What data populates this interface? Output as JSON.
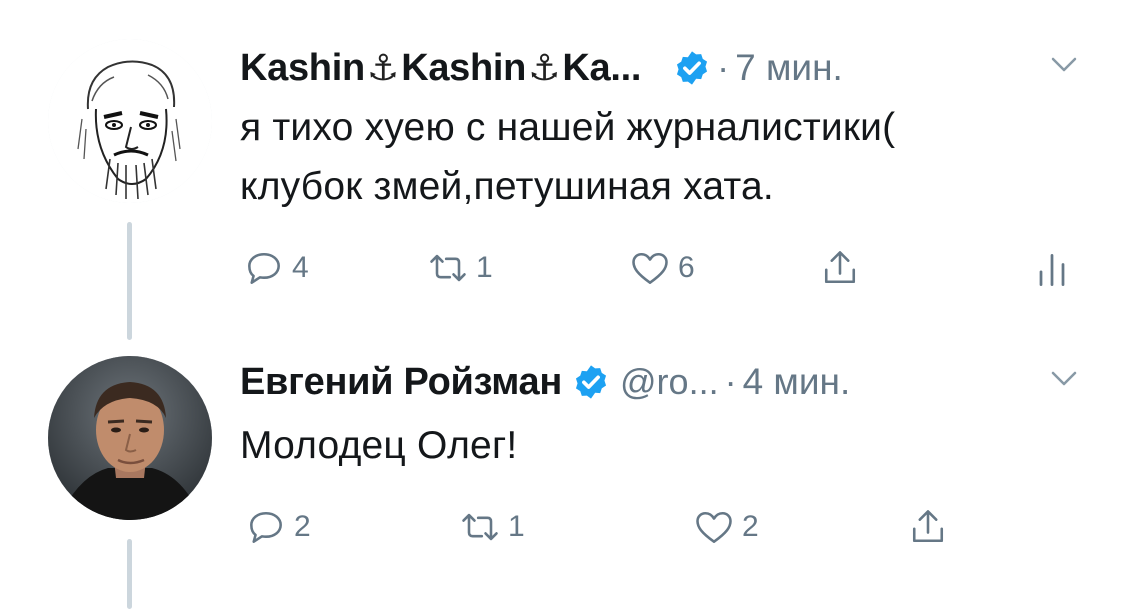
{
  "tweets": [
    {
      "name_part1": "Kashin",
      "name_part2": "Kashin",
      "name_part3": "Ka...",
      "anchor": "⚓",
      "dot": "·",
      "time": "7 мин.",
      "text": "я тихо хуею с нашей журналистики(\nклубок змей,петушиная хата.",
      "reply_count": "4",
      "retweet_count": "1",
      "like_count": "6"
    },
    {
      "name": "Евгений Ройзман",
      "handle": "@ro...",
      "dot": "·",
      "time": "4 мин.",
      "text": "Молодец Олег!",
      "reply_count": "2",
      "retweet_count": "1",
      "like_count": "2"
    }
  ],
  "colors": {
    "text": "#14171a",
    "secondary": "#657786",
    "verified": "#1da1f2",
    "thread_line": "#ccd6dd"
  },
  "icons": [
    "reply-icon",
    "retweet-icon",
    "like-icon",
    "share-icon",
    "analytics-icon",
    "chevron-down-icon",
    "verified-badge-icon"
  ]
}
